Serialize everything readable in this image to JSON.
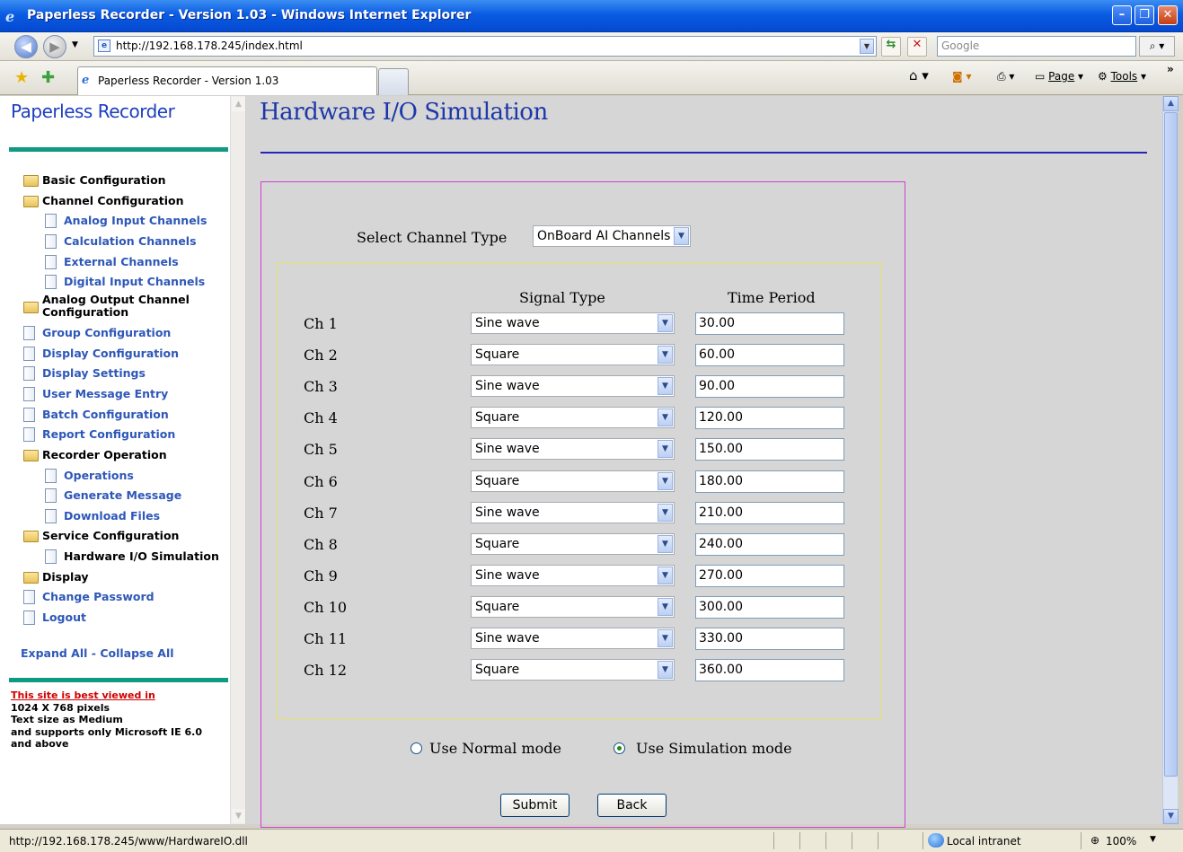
{
  "window": {
    "title": "Paperless Recorder - Version 1.03 - Windows Internet Explorer",
    "minimize": "–",
    "maximize": "❐",
    "close": "✕"
  },
  "browser": {
    "url": "http://192.168.178.245/index.html",
    "search_placeholder": "Google",
    "tab_title": "Paperless Recorder - Version 1.03",
    "cmd_page": "Page",
    "cmd_tools": "Tools",
    "chevron": "»"
  },
  "sidebar": {
    "app_title": "Paperless Recorder",
    "items": [
      {
        "label": "Basic Configuration",
        "kind": "folder"
      },
      {
        "label": "Channel Configuration",
        "kind": "folder-open"
      },
      {
        "label": "Analog Input Channels",
        "kind": "page"
      },
      {
        "label": "Calculation Channels",
        "kind": "page"
      },
      {
        "label": "External Channels",
        "kind": "page"
      },
      {
        "label": "Digital Input Channels",
        "kind": "page"
      },
      {
        "label": "Analog Output Channel Configuration",
        "kind": "folder"
      },
      {
        "label": "Group Configuration",
        "kind": "page"
      },
      {
        "label": "Display Configuration",
        "kind": "page"
      },
      {
        "label": "Display Settings",
        "kind": "page"
      },
      {
        "label": "User Message Entry",
        "kind": "page"
      },
      {
        "label": "Batch Configuration",
        "kind": "page"
      },
      {
        "label": "Report Configuration",
        "kind": "page"
      },
      {
        "label": "Recorder Operation",
        "kind": "folder-open"
      },
      {
        "label": "Operations",
        "kind": "page"
      },
      {
        "label": "Generate Message",
        "kind": "page"
      },
      {
        "label": "Download Files",
        "kind": "page"
      },
      {
        "label": "Service Configuration",
        "kind": "folder-open"
      },
      {
        "label": "Hardware I/O Simulation",
        "kind": "page-current"
      },
      {
        "label": "Display",
        "kind": "folder"
      },
      {
        "label": "Change Password",
        "kind": "page"
      },
      {
        "label": "Logout",
        "kind": "page"
      }
    ],
    "expand_collapse": "Expand All - Collapse All",
    "note_link": "This site is best viewed in",
    "note_lines": [
      "1024 X 768 pixels",
      "Text size as Medium",
      "and supports only Microsoft IE 6.0",
      "and above"
    ]
  },
  "main": {
    "heading": "Hardware I/O Simulation",
    "channel_type_label": "Select Channel Type",
    "channel_type_value": "OnBoard AI Channels",
    "col_signal": "Signal Type",
    "col_period": "Time Period",
    "rows": [
      {
        "ch": "Ch 1",
        "signal": "Sine wave",
        "period": "30.00"
      },
      {
        "ch": "Ch 2",
        "signal": "Square",
        "period": "60.00"
      },
      {
        "ch": "Ch 3",
        "signal": "Sine wave",
        "period": "90.00"
      },
      {
        "ch": "Ch 4",
        "signal": "Square",
        "period": "120.00"
      },
      {
        "ch": "Ch 5",
        "signal": "Sine wave",
        "period": "150.00"
      },
      {
        "ch": "Ch 6",
        "signal": "Square",
        "period": "180.00"
      },
      {
        "ch": "Ch 7",
        "signal": "Sine wave",
        "period": "210.00"
      },
      {
        "ch": "Ch 8",
        "signal": "Square",
        "period": "240.00"
      },
      {
        "ch": "Ch 9",
        "signal": "Sine wave",
        "period": "270.00"
      },
      {
        "ch": "Ch 10",
        "signal": "Square",
        "period": "300.00"
      },
      {
        "ch": "Ch 11",
        "signal": "Sine wave",
        "period": "330.00"
      },
      {
        "ch": "Ch 12",
        "signal": "Square",
        "period": "360.00"
      }
    ],
    "mode_normal": "Use Normal mode",
    "mode_sim": "Use Simulation mode",
    "selected_mode": "simulation",
    "submit": "Submit",
    "back": "Back"
  },
  "status": {
    "url": "http://192.168.178.245/www/HardwareIO.dll",
    "zone": "Local intranet",
    "zoom": "100%"
  }
}
